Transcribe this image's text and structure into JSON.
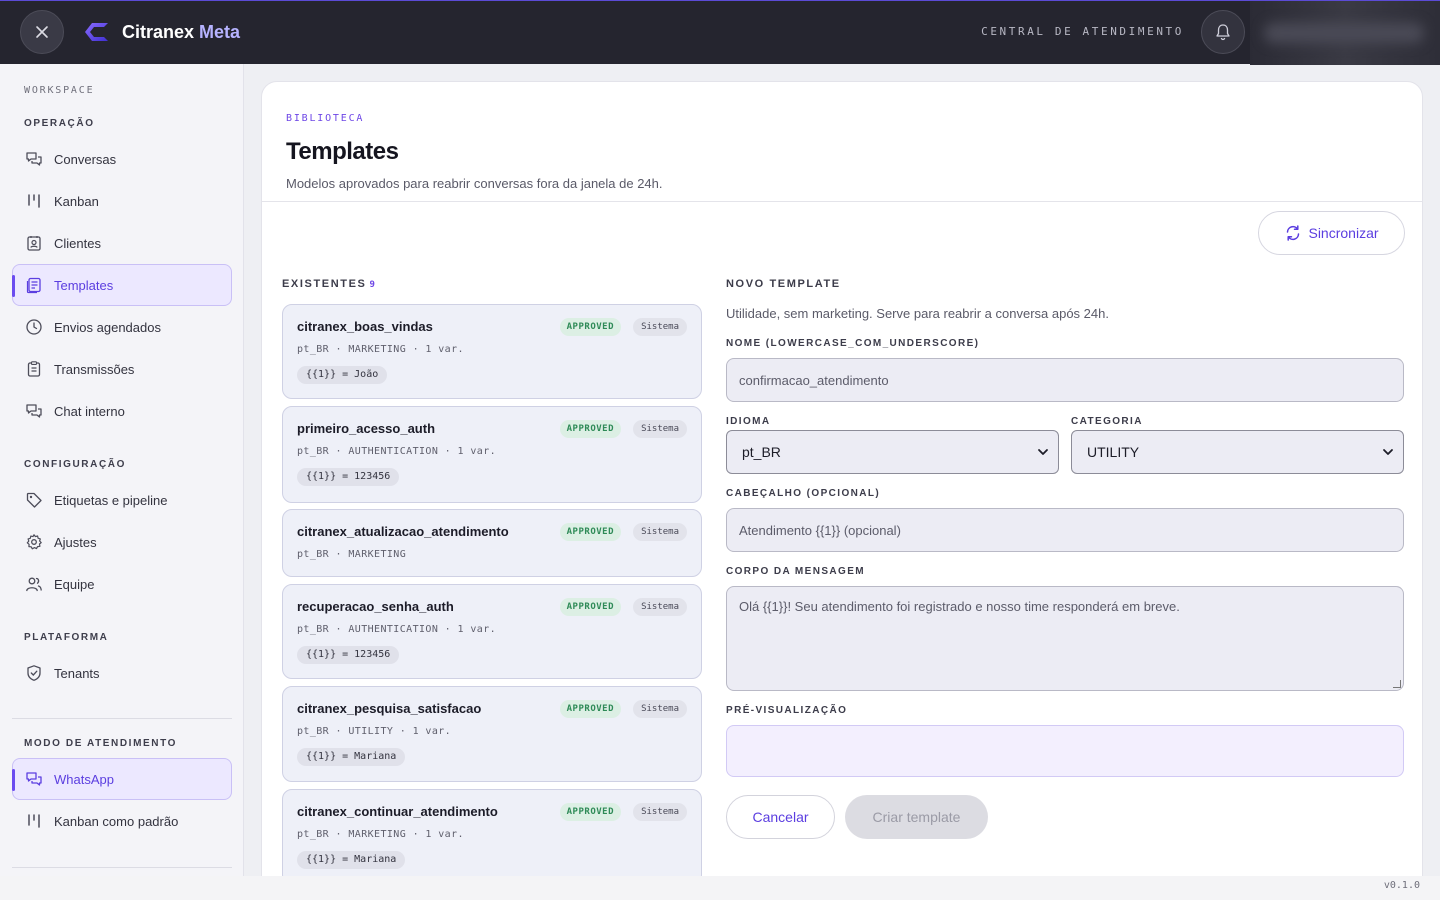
{
  "app": {
    "brand_main": "Citranex",
    "brand_accent": "Meta",
    "header_label": "CENTRAL DE ATENDIMENTO",
    "version": "v0.1.0",
    "accent_color": "#6b4cf0"
  },
  "sidebar": {
    "workspace_label": "WORKSPACE",
    "sections": {
      "operacao": "OPERAÇÃO",
      "configuracao": "CONFIGURAÇÃO",
      "plataforma": "PLATAFORMA",
      "modo": "MODO DE ATENDIMENTO"
    },
    "items": [
      {
        "label": "Conversas",
        "icon": "chat-icon"
      },
      {
        "label": "Kanban",
        "icon": "kanban-icon"
      },
      {
        "label": "Clientes",
        "icon": "contacts-icon"
      },
      {
        "label": "Templates",
        "icon": "template-icon",
        "active": true
      },
      {
        "label": "Envios agendados",
        "icon": "clock-icon"
      },
      {
        "label": "Transmissões",
        "icon": "clipboard-icon"
      },
      {
        "label": "Chat interno",
        "icon": "chat-icon"
      },
      {
        "label": "Etiquetas e pipeline",
        "icon": "tag-icon"
      },
      {
        "label": "Ajustes",
        "icon": "gear-icon"
      },
      {
        "label": "Equipe",
        "icon": "users-icon"
      },
      {
        "label": "Tenants",
        "icon": "shield-icon"
      },
      {
        "label": "WhatsApp",
        "icon": "chat-icon",
        "active": true
      },
      {
        "label": "Kanban como padrão",
        "icon": "kanban-icon"
      }
    ]
  },
  "page": {
    "eyebrow": "BIBLIOTECA",
    "title": "Templates",
    "subtitle": "Modelos aprovados para reabrir conversas fora da janela de 24h.",
    "sync_label": "Sincronizar"
  },
  "existing": {
    "label": "EXISTENTES",
    "count": "9",
    "templates": [
      {
        "name": "citranex_boas_vindas",
        "meta": "pt_BR · MARKETING · 1 var.",
        "var": "{{1}} = João",
        "status": "APPROVED",
        "source": "Sistema"
      },
      {
        "name": "primeiro_acesso_auth",
        "meta": "pt_BR · AUTHENTICATION · 1 var.",
        "var": "{{1}} = 123456",
        "status": "APPROVED",
        "source": "Sistema"
      },
      {
        "name": "citranex_atualizacao_atendimento",
        "meta": "pt_BR · MARKETING",
        "var": null,
        "status": "APPROVED",
        "source": "Sistema"
      },
      {
        "name": "recuperacao_senha_auth",
        "meta": "pt_BR · AUTHENTICATION · 1 var.",
        "var": "{{1}} = 123456",
        "status": "APPROVED",
        "source": "Sistema"
      },
      {
        "name": "citranex_pesquisa_satisfacao",
        "meta": "pt_BR · UTILITY · 1 var.",
        "var": "{{1}} = Mariana",
        "status": "APPROVED",
        "source": "Sistema"
      },
      {
        "name": "citranex_continuar_atendimento",
        "meta": "pt_BR · MARKETING · 1 var.",
        "var": "{{1}} = Mariana",
        "status": "APPROVED",
        "source": "Sistema"
      }
    ]
  },
  "form": {
    "title": "NOVO TEMPLATE",
    "note": "Utilidade, sem marketing. Serve para reabrir a conversa após 24h.",
    "name_label": "NOME (LOWERCASE_COM_UNDERSCORE)",
    "name_placeholder": "confirmacao_atendimento",
    "language_label": "IDIOMA",
    "language_value": "pt_BR",
    "category_label": "CATEGORIA",
    "category_value": "UTILITY",
    "header_label": "CABEÇALHO (OPCIONAL)",
    "header_placeholder": "Atendimento {{1}} (opcional)",
    "body_label": "CORPO DA MENSAGEM",
    "body_placeholder": "Olá {{1}}! Seu atendimento foi registrado e nosso time responderá em breve.",
    "preview_label": "PRÉ-VISUALIZAÇÃO",
    "cancel_label": "Cancelar",
    "create_label": "Criar template"
  }
}
